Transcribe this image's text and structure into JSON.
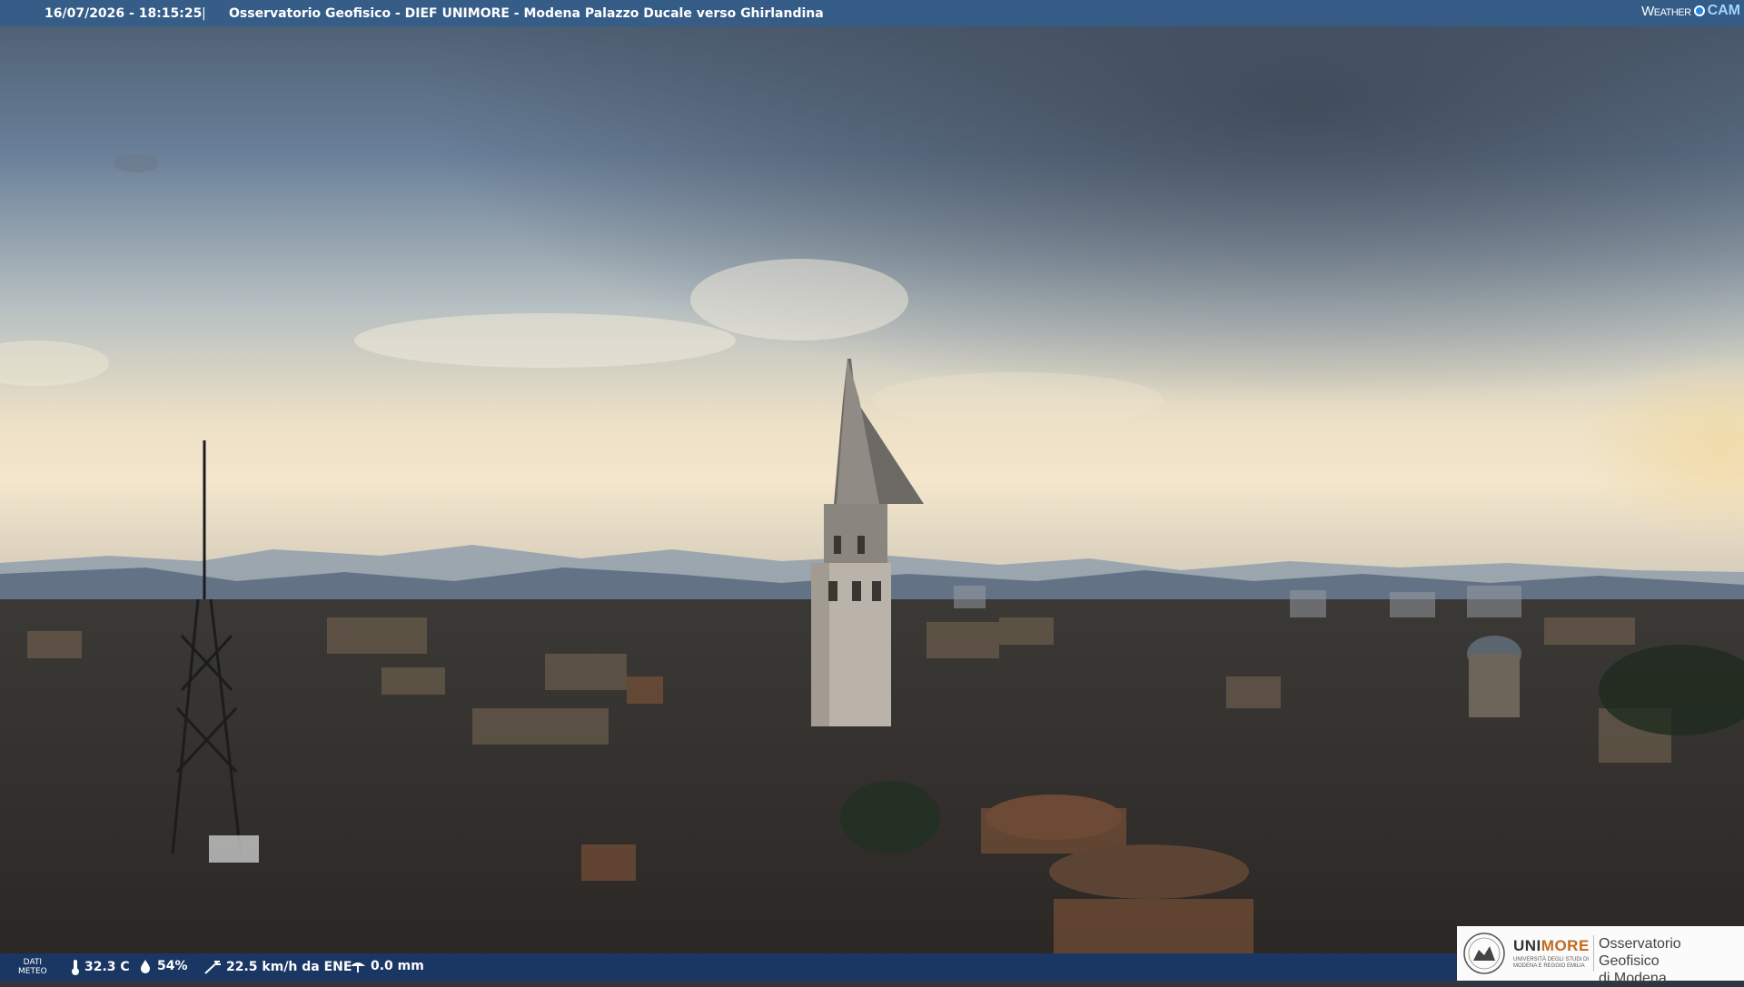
{
  "header": {
    "timestamp": "16/07/2026 - 18:15:25",
    "separator": "|",
    "title": "Osservatorio Geofisico - DIEF UNIMORE - Modena Palazzo Ducale verso Ghirlandina",
    "brand_left": "Weather",
    "brand_right": "CAM"
  },
  "weather": {
    "label_line1": "DATI",
    "label_line2": "METEO",
    "temperature": "32.3 C",
    "humidity": "54%",
    "wind": "22.5 km/h da ENE",
    "rain": "0.0 mm",
    "icons": [
      "thermometer-icon",
      "humidity-drop-icon",
      "wind-icon",
      "rain-gauge-icon"
    ]
  },
  "logo": {
    "uni": "UNI",
    "more": "MORE",
    "sub_line1": "UNIVERSITÀ DEGLI STUDI DI",
    "sub_line2": "MODENA E REGGIO EMILIA",
    "observatory_line1": "Osservatorio Geofisico",
    "observatory_line2": "di Modena"
  },
  "colors": {
    "topbar": "#345c8a",
    "bottombar": "#183a6e",
    "sky_top": "#55677a",
    "sky_glow": "#f1e4c6",
    "unimore_orange": "#c26a1f"
  }
}
